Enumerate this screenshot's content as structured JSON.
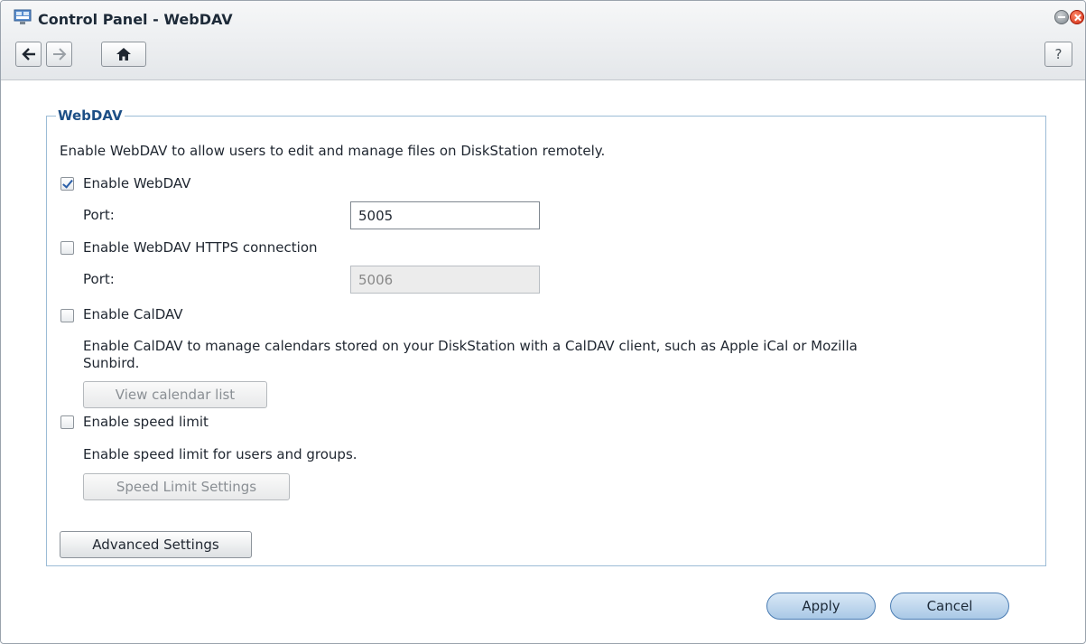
{
  "window": {
    "title": "Control Panel - WebDAV"
  },
  "toolbar": {
    "back_icon": "arrow-left-icon",
    "forward_icon": "arrow-right-icon",
    "home_icon": "home-icon",
    "help_label": "?"
  },
  "section": {
    "legend": "WebDAV",
    "description": "Enable WebDAV to allow users to edit and manage files on DiskStation remotely."
  },
  "webdav": {
    "label": "Enable WebDAV",
    "checked": true,
    "port_label": "Port:",
    "port_value": "5005"
  },
  "https": {
    "label": "Enable WebDAV HTTPS connection",
    "checked": false,
    "port_label": "Port:",
    "port_value": "5006"
  },
  "caldav": {
    "label": "Enable CalDAV",
    "checked": false,
    "description_line1": "Enable CalDAV to manage calendars stored on your DiskStation with a CalDAV client, such as Apple iCal or Mozilla",
    "description_line2": "Sunbird.",
    "button": "View calendar list"
  },
  "speed": {
    "label": "Enable speed limit",
    "checked": false,
    "description": "Enable speed limit for users and groups.",
    "button": "Speed Limit Settings"
  },
  "advanced": {
    "button": "Advanced Settings"
  },
  "footer": {
    "apply": "Apply",
    "cancel": "Cancel"
  },
  "colors": {
    "legend": "#1d4f86",
    "fieldset_border": "#9cbcd6",
    "pill_button": "#a9c8e6"
  }
}
